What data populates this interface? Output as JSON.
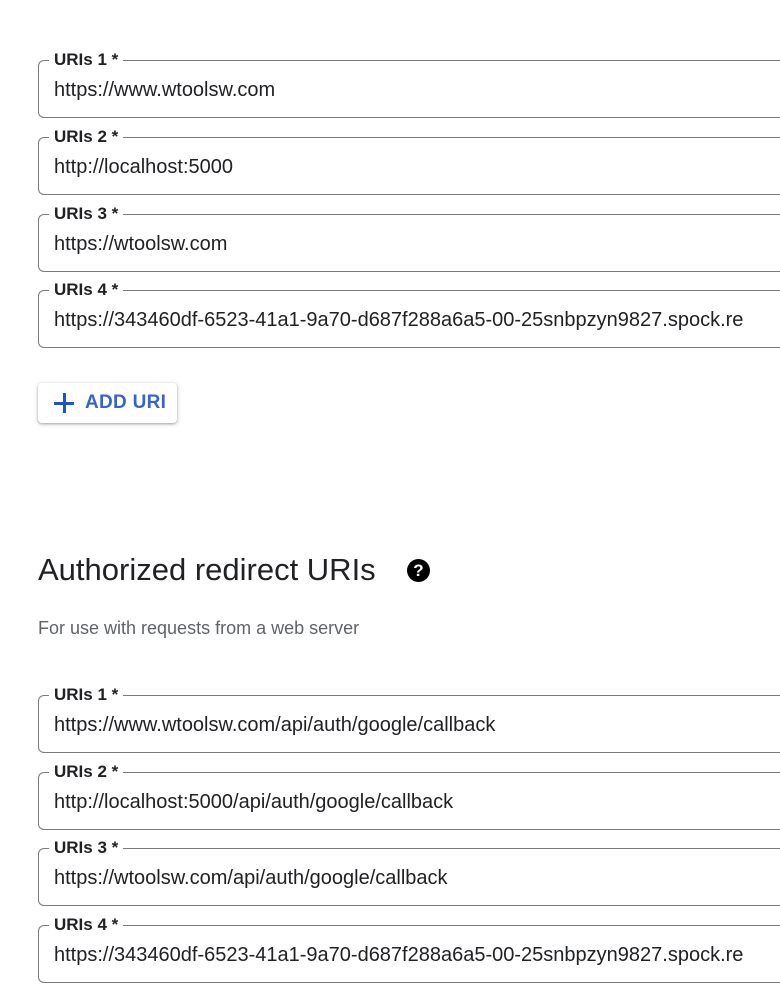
{
  "origins": {
    "fields": [
      {
        "label": "URIs 1 *",
        "value": "https://www.wtoolsw.com"
      },
      {
        "label": "URIs 2 *",
        "value": "http://localhost:5000"
      },
      {
        "label": "URIs 3 *",
        "value": "https://wtoolsw.com"
      },
      {
        "label": "URIs 4 *",
        "value": "https://343460df-6523-41a1-9a70-d687f288a6a5-00-25snbpzyn9827.spock.re"
      }
    ],
    "add_button_label": "ADD URI"
  },
  "redirect": {
    "title": "Authorized redirect URIs",
    "help_icon": "?",
    "description": "For use with requests from a web server",
    "fields": [
      {
        "label": "URIs 1 *",
        "value": "https://www.wtoolsw.com/api/auth/google/callback"
      },
      {
        "label": "URIs 2 *",
        "value": "http://localhost:5000/api/auth/google/callback"
      },
      {
        "label": "URIs 3 *",
        "value": "https://wtoolsw.com/api/auth/google/callback"
      },
      {
        "label": "URIs 4 *",
        "value": "https://343460df-6523-41a1-9a70-d687f288a6a5-00-25snbpzyn9827.spock.re"
      }
    ]
  },
  "colors": {
    "accent": "#1a56c4",
    "border": "#7a7a7a",
    "text": "#202124",
    "secondary_text": "#5f6368"
  },
  "icons": {
    "add": "plus-icon",
    "help": "help-circle-icon"
  }
}
